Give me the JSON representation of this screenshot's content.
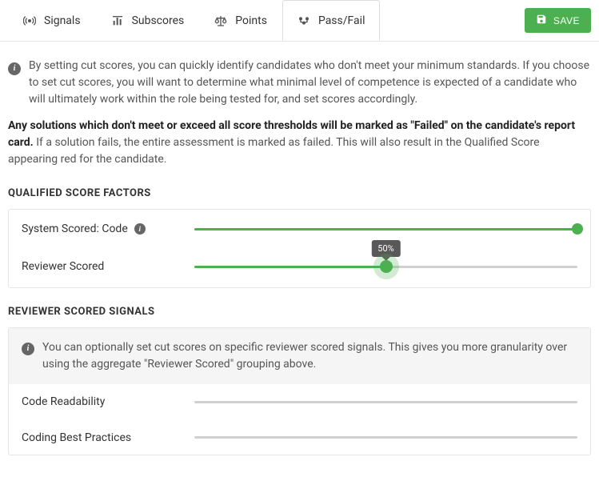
{
  "tabs": {
    "signals": {
      "label": "Signals"
    },
    "subscores": {
      "label": "Subscores"
    },
    "points": {
      "label": "Points"
    },
    "passfail": {
      "label": "Pass/Fail"
    }
  },
  "save_button": {
    "label": "SAVE"
  },
  "intro_text": "By setting cut scores, you can quickly identify candidates who don't meet your minimum standards. If you choose to set cut scores, you will want to determine what minimal level of competence is expected of a candidate who will ultimately work within the role being tested for, and set scores accordingly.",
  "warn_bold": "Any solutions which don't meet or exceed all score thresholds will be marked as \"Failed\" on the candidate's report card.",
  "warn_rest": " If a solution fails, the entire assessment is marked as failed. This will also result in the Qualified Score appearing red for the candidate.",
  "sections": {
    "factors_title": "QUALIFIED SCORE FACTORS",
    "signals_title": "REVIEWER SCORED SIGNALS"
  },
  "factors": {
    "system": {
      "label": "System Scored: Code",
      "value": 100
    },
    "reviewer": {
      "label": "Reviewer Scored",
      "value": 50,
      "tooltip": "50%"
    }
  },
  "signals_info": "You can optionally set cut scores on specific reviewer scored signals. This gives you more granularity over using the aggregate \"Reviewer Scored\" grouping above.",
  "signals": {
    "readability": {
      "label": "Code Readability",
      "value": 0
    },
    "bestpractices": {
      "label": "Coding Best Practices",
      "value": 0
    }
  }
}
